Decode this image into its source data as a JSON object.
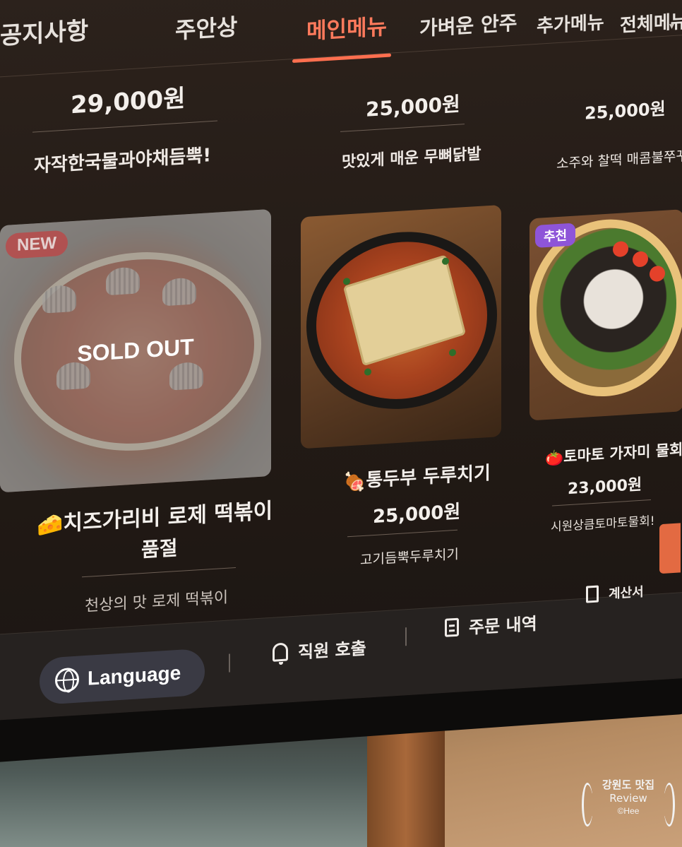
{
  "nav": {
    "tabs": [
      {
        "label": "공지사항"
      },
      {
        "label": "주안상"
      },
      {
        "label": "메인메뉴",
        "active": true
      },
      {
        "label": "가벼운 안주"
      },
      {
        "label": "추가메뉴"
      },
      {
        "label": "전체메뉴"
      }
    ]
  },
  "top_row": [
    {
      "price": "29,000원",
      "desc": "자작한국물과야채듬뿍!"
    },
    {
      "price": "25,000원",
      "desc": "맛있게 매운 무뼈닭발"
    },
    {
      "price": "25,000원",
      "desc": "소주와 찰떡 매콤불쭈꾸"
    }
  ],
  "menu_items": [
    {
      "badge": "NEW",
      "status": "SOLD OUT",
      "emoji": "🧀",
      "name_line1": "치즈가리비 로제 떡볶이",
      "name_line2": "품절",
      "desc": "천상의 맛 로제 떡볶이"
    },
    {
      "emoji": "🍖",
      "name": "통두부 두루치기",
      "price": "25,000원",
      "desc": "고기듬뿍두루치기"
    },
    {
      "badge": "추천",
      "emoji": "🍅",
      "name": "토마토 가자미 물회",
      "price": "23,000원",
      "desc": "시원상큼토마토물회!"
    }
  ],
  "bottom_bar": {
    "language_label": "Language",
    "staff_call_label": "직원 호출",
    "order_history_label": "주문 내역",
    "bill_label": "계산서"
  },
  "watermark": {
    "line1": "강원도 맛집",
    "line2": "Review",
    "line3": "©Hee"
  },
  "colors": {
    "accent": "#ff7a5c",
    "badge_new": "#b94a4a",
    "badge_recommend": "#8e55d8"
  }
}
